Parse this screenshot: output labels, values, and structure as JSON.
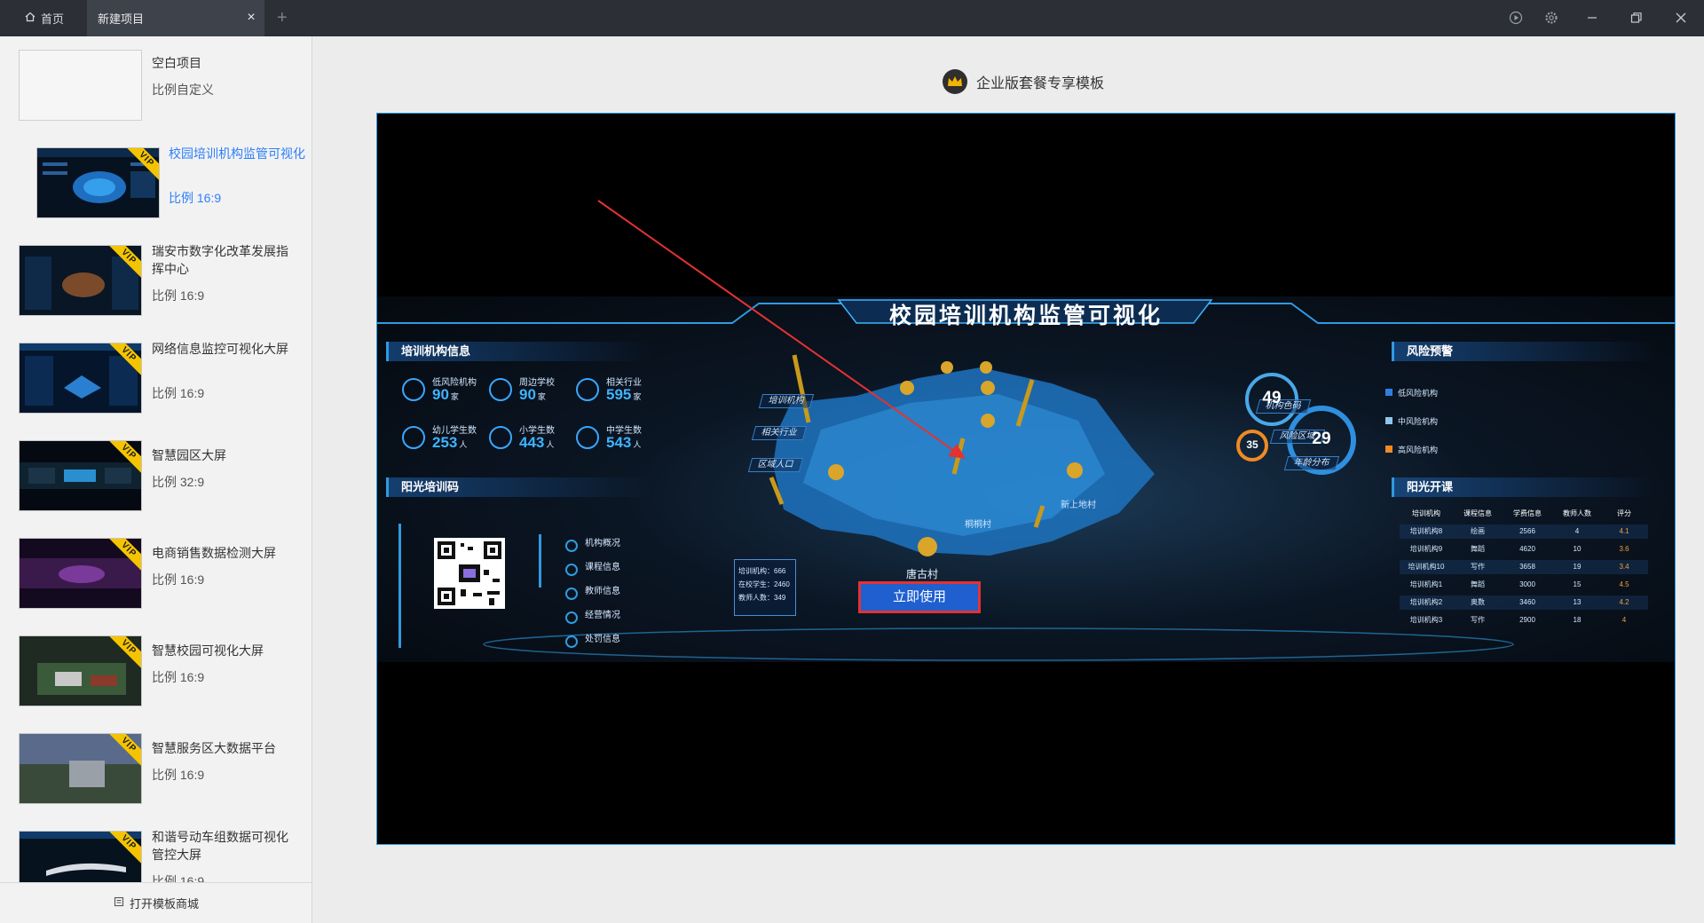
{
  "tabs": {
    "home": "首页",
    "project": "新建项目",
    "close": "×",
    "add": "+"
  },
  "window_icons": [
    "play-icon",
    "settings-gear-icon",
    "minimize-icon",
    "restore-icon",
    "close-icon"
  ],
  "sidebar": {
    "templates": [
      {
        "title": "空白项目",
        "ratio": "比例自定义",
        "blank": true,
        "vip": false
      },
      {
        "title": "校园培训机构监管可视化",
        "ratio": "比例 16:9",
        "vip": true,
        "selected": true
      },
      {
        "title": "瑞安市数字化改革发展指挥中心",
        "ratio": "比例 16:9",
        "vip": true
      },
      {
        "title": "网络信息监控可视化大屏",
        "ratio": "比例 16:9",
        "vip": true
      },
      {
        "title": "智慧园区大屏",
        "ratio": "比例 32:9",
        "vip": true
      },
      {
        "title": "电商销售数据检测大屏",
        "ratio": "比例 16:9",
        "vip": true
      },
      {
        "title": "智慧校园可视化大屏",
        "ratio": "比例 16:9",
        "vip": true
      },
      {
        "title": "智慧服务区大数据平台",
        "ratio": "比例 16:9",
        "vip": true
      },
      {
        "title": "和谐号动车组数据可视化管控大屏",
        "ratio": "比例 16:9",
        "vip": true
      }
    ],
    "vip_badge": "VIP",
    "footer": "打开模板商城"
  },
  "main": {
    "header": "企业版套餐专享模板",
    "preview": {
      "title": "校园培训机构监管可视化",
      "cta": "立即使用",
      "left_sections": {
        "info": "培训机构信息",
        "sunshine": "阳光培训码"
      },
      "right_sections": {
        "risk": "风险预警",
        "courses": "阳光开课"
      },
      "stats": [
        {
          "label": "低风险机构",
          "value": "90",
          "unit": "家"
        },
        {
          "label": "周边学校",
          "value": "90",
          "unit": "家"
        },
        {
          "label": "相关行业",
          "value": "595",
          "unit": "家"
        },
        {
          "label": "幼儿学生数",
          "value": "253",
          "unit": "人"
        },
        {
          "label": "小学生数",
          "value": "443",
          "unit": "人"
        },
        {
          "label": "中学生数",
          "value": "543",
          "unit": "人"
        }
      ],
      "qr_menu": [
        "机构概况",
        "课程信息",
        "教师信息",
        "经营情况",
        "处罚信息"
      ],
      "map_labels": [
        "培训机构",
        "相关行业",
        "区域人口",
        "机构色码",
        "风险区域",
        "年龄分布"
      ],
      "place_names": [
        "唐古村",
        "桐桐村",
        "新上地村"
      ],
      "info_box": [
        "培训机构：666",
        "在校学生：2460",
        "教师人数：349"
      ],
      "risk": {
        "outer": "49",
        "inner": "29",
        "small": "35",
        "legend": [
          "低风险机构",
          "中风险机构",
          "高风险机构"
        ]
      },
      "table": {
        "headers": [
          "培训机构",
          "课程信息",
          "学费信息",
          "教师人数",
          "评分"
        ],
        "rows": [
          [
            "培训机构8",
            "绘画",
            "2566",
            "4",
            "4.1"
          ],
          [
            "培训机构9",
            "舞蹈",
            "4620",
            "10",
            "3.6"
          ],
          [
            "培训机构10",
            "写作",
            "3658",
            "19",
            "3.4"
          ],
          [
            "培训机构1",
            "舞蹈",
            "3000",
            "15",
            "4.5"
          ],
          [
            "培训机构2",
            "奥数",
            "3460",
            "13",
            "4.2"
          ],
          [
            "培训机构3",
            "写作",
            "2900",
            "18",
            "4"
          ]
        ]
      }
    }
  },
  "colors": {
    "accent": "#2d7ff9",
    "titlebar": "#2c2f35",
    "vip": "#f5c400",
    "cta_border": "#e33232",
    "arrow": "#e33232"
  }
}
